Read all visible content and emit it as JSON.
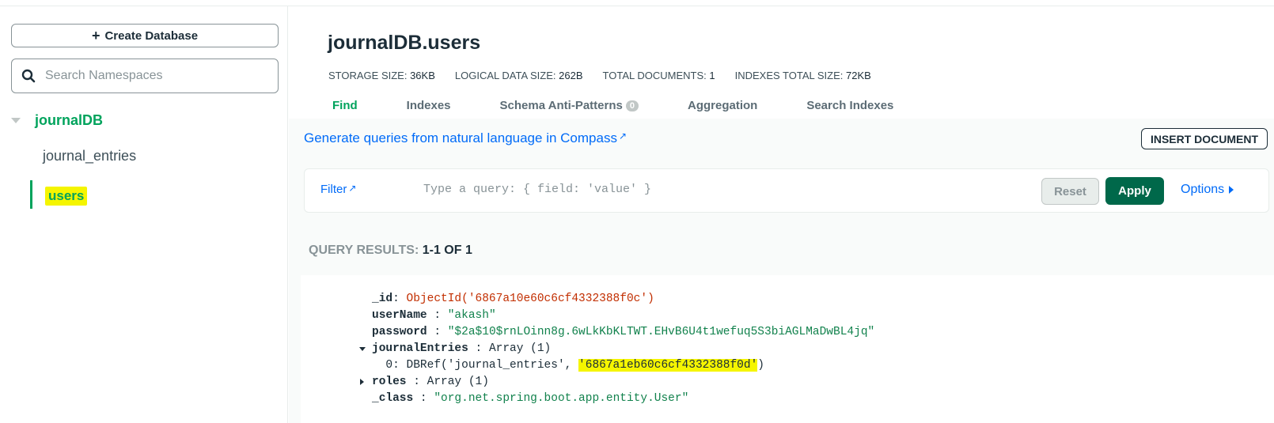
{
  "sidebar": {
    "create_database_label": "Create Database",
    "search_placeholder": "Search Namespaces",
    "database_name": "journalDB",
    "collections": [
      "journal_entries",
      "users"
    ]
  },
  "main": {
    "title": "journalDB.users",
    "stats": [
      {
        "label": "STORAGE SIZE:",
        "value": "36KB"
      },
      {
        "label": "LOGICAL DATA SIZE:",
        "value": "262B"
      },
      {
        "label": "TOTAL DOCUMENTS:",
        "value": "1"
      },
      {
        "label": "INDEXES TOTAL SIZE:",
        "value": "72KB"
      }
    ],
    "tabs": [
      "Find",
      "Indexes",
      "Schema Anti-Patterns",
      "Aggregation",
      "Search Indexes"
    ],
    "schema_badge": "0",
    "generate_link": "Generate queries from natural language in Compass",
    "insert_document_label": "INSERT DOCUMENT",
    "filter": {
      "label": "Filter",
      "placeholder": "Type a query: { field: 'value' }",
      "reset_label": "Reset",
      "apply_label": "Apply",
      "options_label": "Options"
    },
    "results": {
      "label": "QUERY RESULTS:",
      "count": "1-1 OF 1"
    },
    "document": {
      "id_key": "_id",
      "id_value": "ObjectId('6867a10e60c6cf4332388f0c')",
      "username_key": "userName",
      "username_value": "\"akash\"",
      "password_key": "password",
      "password_value": "\"$2a$10$rnLOinn8g.6wLkKbKLTWT.EHvB6U4t1wefuq5S3biAGLMaDwBL4jq\"",
      "journal_key": "journalEntries",
      "journal_value": "Array (1)",
      "journal_item_prefix": "0: DBRef('journal_entries', ",
      "journal_item_id": "'6867a1eb60c6cf4332388f0d'",
      "journal_item_suffix": ")",
      "roles_key": "roles",
      "roles_value": "Array (1)",
      "class_key": "_class",
      "class_value": "\"org.net.spring.boot.app.entity.User\""
    }
  },
  "colors": {
    "accent_green": "#00a35c",
    "apply_green": "#00684a",
    "link_blue": "#016bf8",
    "highlight_yellow": "#f5f500"
  }
}
